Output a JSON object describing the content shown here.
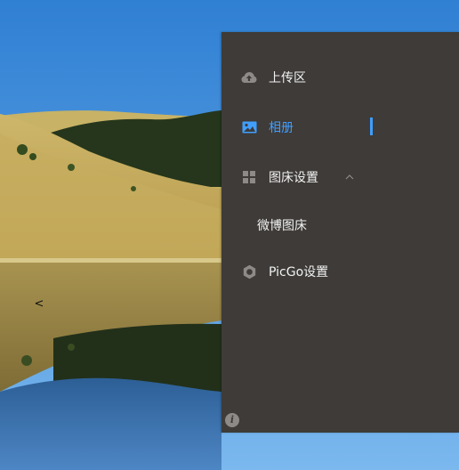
{
  "background": {
    "back_arrow": "<"
  },
  "sidebar": {
    "items": [
      {
        "label": "上传区",
        "icon": "cloud-upload-icon",
        "active": false
      },
      {
        "label": "相册",
        "icon": "image-icon",
        "active": true
      },
      {
        "label": "图床设置",
        "icon": "grid-icon",
        "active": false,
        "expanded": true
      },
      {
        "label": "PicGo设置",
        "icon": "gear-icon",
        "active": false
      }
    ],
    "submenu": [
      {
        "label": "微博图床"
      }
    ],
    "info": "i"
  },
  "colors": {
    "panel_bg": "#3e3b38",
    "accent": "#409eff",
    "text": "#f2f2f2",
    "icon": "#8d8a87"
  }
}
